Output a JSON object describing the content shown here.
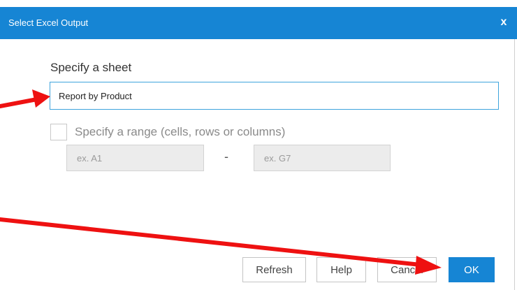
{
  "dialog": {
    "title": "Select Excel Output",
    "close_label": "x"
  },
  "sheet": {
    "label": "Specify a sheet",
    "value": "Report by Product"
  },
  "range": {
    "label": "Specify a range (cells, rows or columns)",
    "checked": false,
    "from_placeholder": "ex. A1",
    "separator": "-",
    "to_placeholder": "ex. G7"
  },
  "buttons": {
    "refresh": "Refresh",
    "help": "Help",
    "cancel": "Cancel",
    "ok": "OK"
  },
  "colors": {
    "accent": "#1685d4",
    "annotation_arrow": "#ee1111"
  }
}
